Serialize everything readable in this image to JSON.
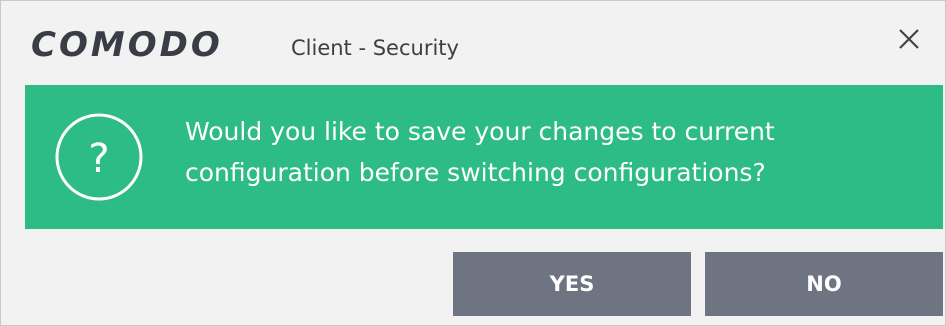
{
  "window": {
    "brand_logo": "COMODO",
    "title": "Client - Security",
    "close_icon": "close-x-icon"
  },
  "message": {
    "icon": "question-circle-icon",
    "text": "Would you like to save your changes to current configuration before switching configurations?"
  },
  "buttons": {
    "yes_label": "YES",
    "no_label": "NO"
  },
  "colors": {
    "banner": "#2dbb86",
    "button": "#6f7482",
    "dialog_bg": "#f2f2f2"
  }
}
